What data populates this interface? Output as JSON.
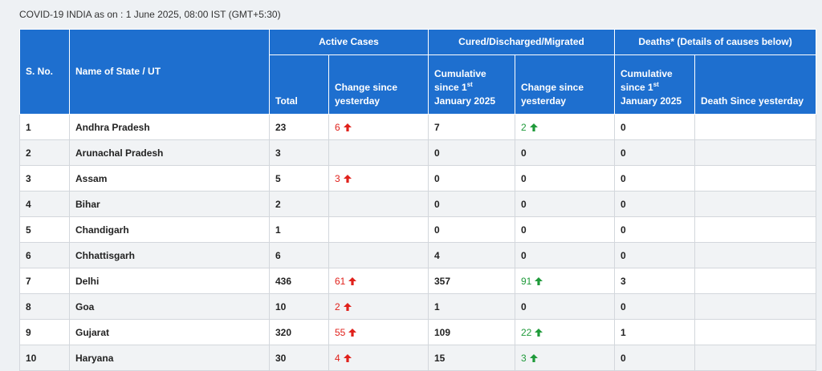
{
  "caption": "COVID-19 INDIA as on : 1 June 2025, 08:00 IST (GMT+5:30)",
  "colors": {
    "header_bg": "#1e6fcf",
    "increase_red": "#e0211b",
    "increase_green": "#1f9a3a"
  },
  "header": {
    "sno": "S. No.",
    "state": "Name of State / UT",
    "active_group": "Active Cases",
    "cured_group": "Cured/Discharged/Migrated",
    "deaths_group": "Deaths* (Details of causes below)",
    "active_total": "Total",
    "active_change": "Change since yesterday",
    "cured_cum_a": "Cumulative since 1",
    "cured_cum_sup": "st",
    "cured_cum_b": "January 2025",
    "cured_change": "Change since yesterday",
    "deaths_cum_a": "Cumulative since 1",
    "deaths_cum_sup": "st",
    "deaths_cum_b": "January 2025",
    "deaths_since": "Death Since yesterday"
  },
  "rows": [
    {
      "sno": "1",
      "state": "Andhra Pradesh",
      "active_total": "23",
      "active_change": "6",
      "cured_cum": "7",
      "cured_change": "2",
      "deaths_cum": "0",
      "deaths_since": ""
    },
    {
      "sno": "2",
      "state": "Arunachal Pradesh",
      "active_total": "3",
      "active_change": "",
      "cured_cum": "0",
      "cured_change": "0",
      "deaths_cum": "0",
      "deaths_since": ""
    },
    {
      "sno": "3",
      "state": "Assam",
      "active_total": "5",
      "active_change": "3",
      "cured_cum": "0",
      "cured_change": "0",
      "deaths_cum": "0",
      "deaths_since": ""
    },
    {
      "sno": "4",
      "state": "Bihar",
      "active_total": "2",
      "active_change": "",
      "cured_cum": "0",
      "cured_change": "0",
      "deaths_cum": "0",
      "deaths_since": ""
    },
    {
      "sno": "5",
      "state": "Chandigarh",
      "active_total": "1",
      "active_change": "",
      "cured_cum": "0",
      "cured_change": "0",
      "deaths_cum": "0",
      "deaths_since": ""
    },
    {
      "sno": "6",
      "state": "Chhattisgarh",
      "active_total": "6",
      "active_change": "",
      "cured_cum": "4",
      "cured_change": "0",
      "deaths_cum": "0",
      "deaths_since": ""
    },
    {
      "sno": "7",
      "state": "Delhi",
      "active_total": "436",
      "active_change": "61",
      "cured_cum": "357",
      "cured_change": "91",
      "deaths_cum": "3",
      "deaths_since": ""
    },
    {
      "sno": "8",
      "state": "Goa",
      "active_total": "10",
      "active_change": "2",
      "cured_cum": "1",
      "cured_change": "0",
      "deaths_cum": "0",
      "deaths_since": ""
    },
    {
      "sno": "9",
      "state": "Gujarat",
      "active_total": "320",
      "active_change": "55",
      "cured_cum": "109",
      "cured_change": "22",
      "deaths_cum": "1",
      "deaths_since": ""
    },
    {
      "sno": "10",
      "state": "Haryana",
      "active_total": "30",
      "active_change": "4",
      "cured_cum": "15",
      "cured_change": "3",
      "deaths_cum": "0",
      "deaths_since": ""
    }
  ]
}
